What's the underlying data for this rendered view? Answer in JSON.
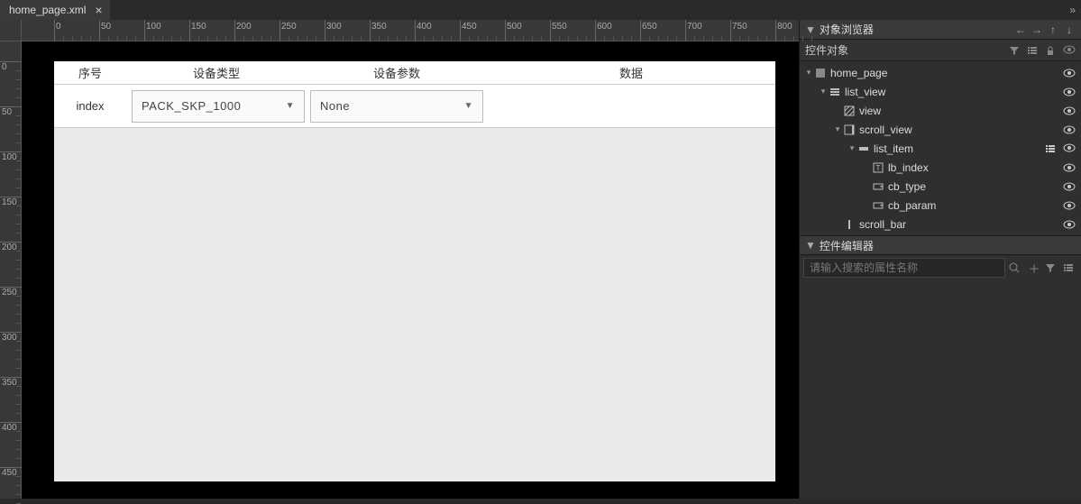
{
  "tab": {
    "filename": "home_page.xml",
    "close": "×",
    "overflow": "»"
  },
  "ruler": {
    "h_labels": [
      "0",
      "50",
      "100",
      "150",
      "200",
      "250",
      "300",
      "350",
      "400",
      "450",
      "500",
      "550",
      "600",
      "650",
      "700",
      "750",
      "800"
    ],
    "v_labels": [
      "0",
      "50",
      "100",
      "150",
      "200",
      "250",
      "300",
      "350",
      "400",
      "450"
    ]
  },
  "page": {
    "headers": {
      "col1": "序号",
      "col2": "设备类型",
      "col3": "设备参数",
      "col4": "数据"
    },
    "row": {
      "index": "index",
      "type_value": "PACK_SKP_1000",
      "param_value": "None"
    }
  },
  "panel": {
    "object_browser_title": "对象浏览器",
    "control_objects_title": "控件对象",
    "control_editor_title": "控件编辑器",
    "search_placeholder": "请输入搜索的属性名称"
  },
  "tree": [
    {
      "depth": 0,
      "expander": "▾",
      "icon": "page",
      "label": "home_page"
    },
    {
      "depth": 1,
      "expander": "▾",
      "icon": "list",
      "label": "list_view"
    },
    {
      "depth": 2,
      "expander": "",
      "icon": "hatch",
      "label": "view"
    },
    {
      "depth": 2,
      "expander": "▾",
      "icon": "scroll",
      "label": "scroll_view"
    },
    {
      "depth": 3,
      "expander": "▾",
      "icon": "item",
      "label": "list_item",
      "extra": "list"
    },
    {
      "depth": 4,
      "expander": "",
      "icon": "text",
      "label": "lb_index"
    },
    {
      "depth": 4,
      "expander": "",
      "icon": "combo",
      "label": "cb_type"
    },
    {
      "depth": 4,
      "expander": "",
      "icon": "combo",
      "label": "cb_param"
    },
    {
      "depth": 2,
      "expander": "",
      "icon": "bar",
      "label": "scroll_bar"
    }
  ]
}
